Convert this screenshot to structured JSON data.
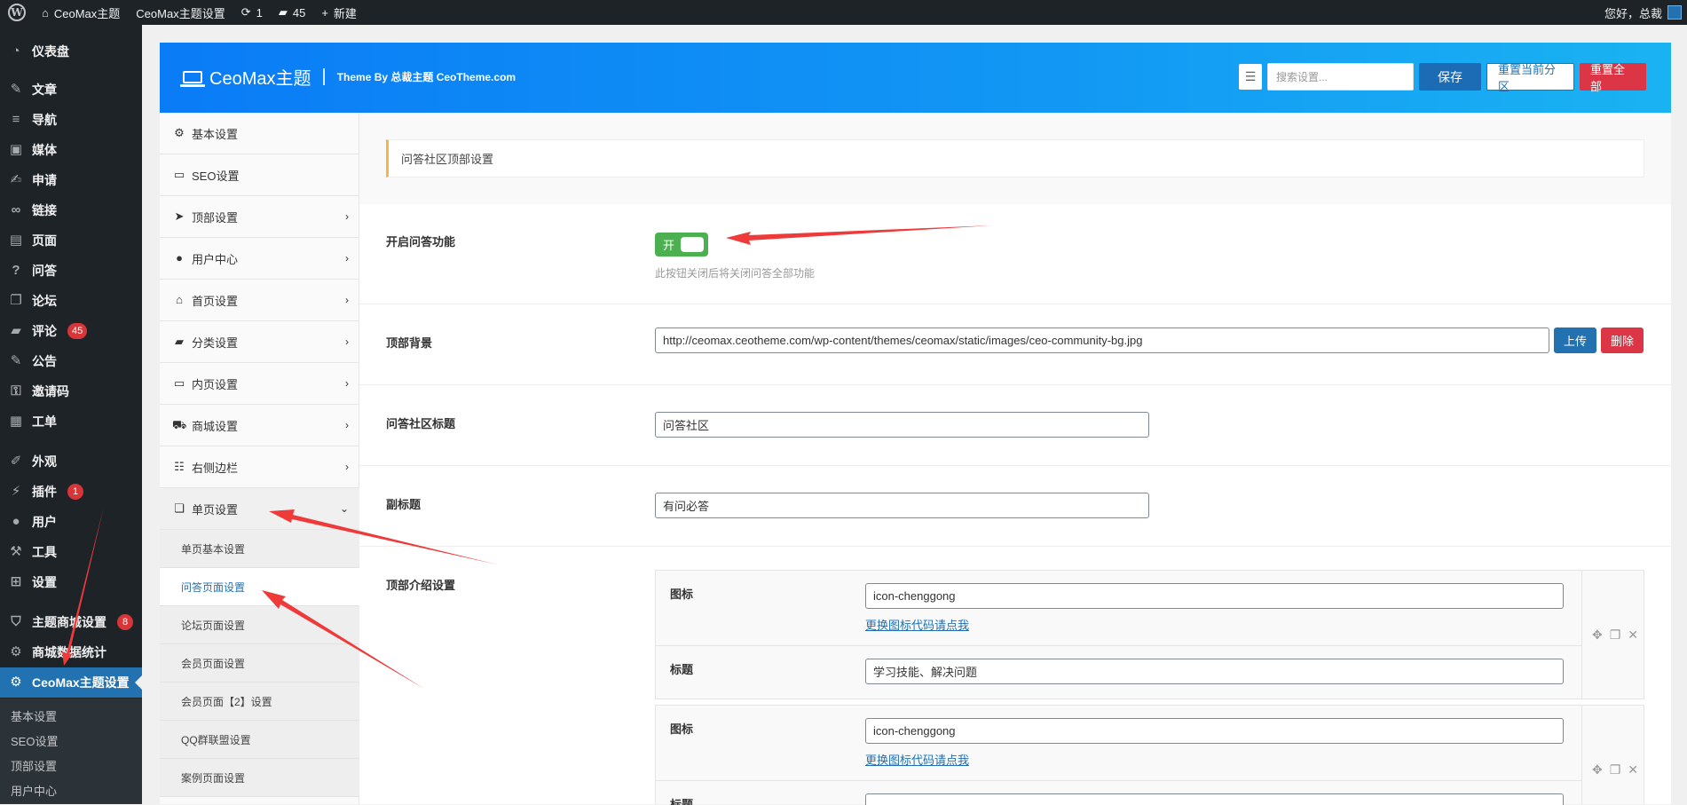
{
  "adminbar": {
    "site_name": "CeoMax主题",
    "theme_settings": "CeoMax主题设置",
    "updates_count": "1",
    "comments_count": "45",
    "new_label": "新建",
    "greeting": "您好，总裁"
  },
  "sidebar": {
    "items": [
      {
        "label": "仪表盘",
        "icon": "dashboard-icon"
      },
      {
        "label": "文章",
        "icon": "pin-icon"
      },
      {
        "label": "导航",
        "icon": "list-icon"
      },
      {
        "label": "媒体",
        "icon": "media-icon"
      },
      {
        "label": "申请",
        "icon": "edit-icon"
      },
      {
        "label": "链接",
        "icon": "link-icon"
      },
      {
        "label": "页面",
        "icon": "page-icon"
      },
      {
        "label": "问答",
        "icon": "question-icon"
      },
      {
        "label": "论坛",
        "icon": "forum-icon"
      },
      {
        "label": "评论",
        "icon": "comment-icon",
        "badge": "45"
      },
      {
        "label": "公告",
        "icon": "pin-icon"
      },
      {
        "label": "邀请码",
        "icon": "key-icon"
      },
      {
        "label": "工单",
        "icon": "ticket-icon"
      },
      {
        "label": "外观",
        "icon": "brush-icon"
      },
      {
        "label": "插件",
        "icon": "plugin-icon",
        "badge": "1"
      },
      {
        "label": "用户",
        "icon": "user-icon"
      },
      {
        "label": "工具",
        "icon": "wrench-icon"
      },
      {
        "label": "设置",
        "icon": "settings-icon"
      },
      {
        "label": "主题商城设置",
        "icon": "shield-icon",
        "badge": "8"
      },
      {
        "label": "商城数据统计",
        "icon": "gear-icon"
      },
      {
        "label": "CeoMax主题设置",
        "icon": "gear-icon",
        "current": true
      }
    ],
    "submenu": [
      "基本设置",
      "SEO设置",
      "顶部设置",
      "用户中心"
    ]
  },
  "header": {
    "title": "CeoMax主题",
    "subtitle": "Theme By 总裁主题 CeoTheme.com",
    "search_placeholder": "搜索设置...",
    "save": "保存",
    "reset_section": "重置当前分区",
    "reset_all": "重置全部"
  },
  "optnav": {
    "items": [
      {
        "label": "基本设置",
        "icon": "gear-icon",
        "arrow": ""
      },
      {
        "label": "SEO设置",
        "icon": "monitor-icon",
        "arrow": ""
      },
      {
        "label": "顶部设置",
        "icon": "send-icon",
        "arrow": "›"
      },
      {
        "label": "用户中心",
        "icon": "user-icon",
        "arrow": "›"
      },
      {
        "label": "首页设置",
        "icon": "home-icon",
        "arrow": "›"
      },
      {
        "label": "分类设置",
        "icon": "folder-icon",
        "arrow": "›"
      },
      {
        "label": "内页设置",
        "icon": "window-icon",
        "arrow": "›"
      },
      {
        "label": "商城设置",
        "icon": "cart-icon",
        "arrow": "›"
      },
      {
        "label": "右侧边栏",
        "icon": "list-icon",
        "arrow": "›"
      },
      {
        "label": "单页设置",
        "icon": "copy-icon",
        "arrow": "⌄"
      }
    ],
    "subitems": [
      "单页基本设置",
      "问答页面设置",
      "论坛页面设置",
      "会员页面设置",
      "会员页面【2】设置",
      "QQ群联盟设置",
      "案例页面设置"
    ]
  },
  "content": {
    "section_title": "问答社区顶部设置",
    "qa_switch_label": "开启问答功能",
    "qa_switch_text": "开",
    "qa_switch_desc": "此按钮关闭后将关闭问答全部功能",
    "bg_label": "顶部背景",
    "bg_value": "http://ceomax.ceotheme.com/wp-content/themes/ceomax/static/images/ceo-community-bg.jpg",
    "upload": "上传",
    "delete": "删除",
    "title_label": "问答社区标题",
    "title_value": "问答社区",
    "subtitle_label": "副标题",
    "subtitle_value": "有问必答",
    "intro_label": "顶部介绍设置",
    "groups": [
      {
        "icon_label": "图标",
        "icon_value": "icon-chenggong",
        "icon_link": "更换图标代码请点我",
        "title_label": "标题",
        "title_value": "学习技能、解决问题"
      },
      {
        "icon_label": "图标",
        "icon_value": "icon-chenggong",
        "icon_link": "更换图标代码请点我",
        "title_label": "标题",
        "title_value": ""
      }
    ]
  }
}
